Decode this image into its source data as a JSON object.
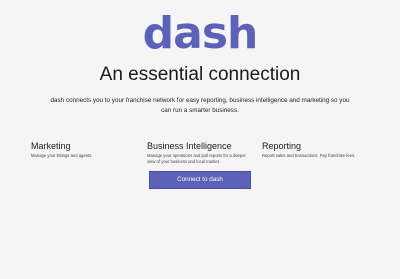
{
  "brand": {
    "logo_text": "dash",
    "accent_color": "#5b62b8"
  },
  "hero": {
    "headline": "An essential connection",
    "intro": "dash connects you to your franchise network for easy reporting, business intelligence and marketing so you can run a smarter business."
  },
  "features": [
    {
      "title": "Marketing",
      "description": "Manage your listings and agents."
    },
    {
      "title": "Business Intelligence",
      "description": "Manage your operations and pull reports for a deeper view of your business and local market."
    },
    {
      "title": "Reporting",
      "description": "Report sales and transactions. Pay franchise fees."
    }
  ],
  "cta": {
    "label": "Connect to dash"
  }
}
